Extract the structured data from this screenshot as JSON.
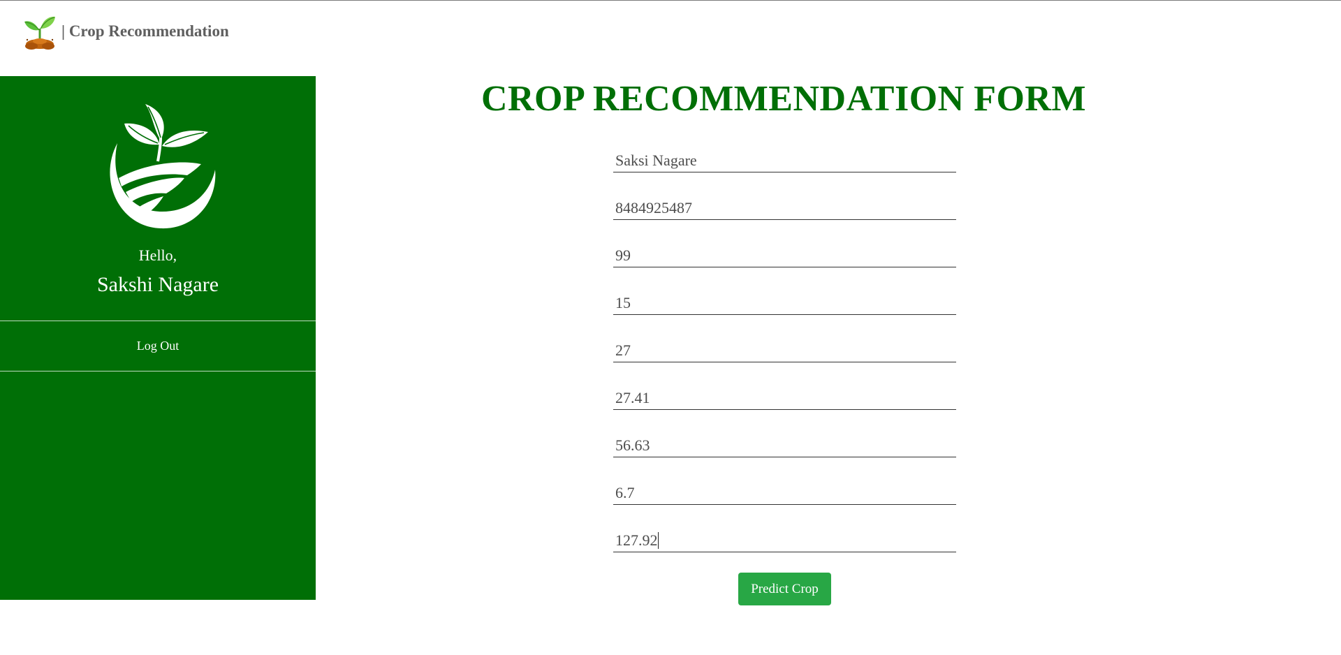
{
  "navbar": {
    "brand_text": "| Crop Recommendation",
    "logo_icon": "sprout-in-soil-icon"
  },
  "sidebar": {
    "logo_icon": "leaf-field-circle-icon",
    "greeting": "Hello,",
    "user_name": "Sakshi Nagare",
    "logout_label": "Log Out"
  },
  "form": {
    "title": "CROP RECOMMENDATION FORM",
    "fields": [
      {
        "value": "Saksi Nagare"
      },
      {
        "value": "8484925487"
      },
      {
        "value": "99"
      },
      {
        "value": "15"
      },
      {
        "value": "27"
      },
      {
        "value": "27.41"
      },
      {
        "value": "56.63"
      },
      {
        "value": "6.7"
      },
      {
        "value": "127.92"
      }
    ],
    "submit_label": "Predict Crop"
  },
  "colors": {
    "sidebar_bg": "#006f06",
    "title_color": "#006f06",
    "button_bg": "#28a745",
    "brand_text": "#5f5f5f"
  }
}
